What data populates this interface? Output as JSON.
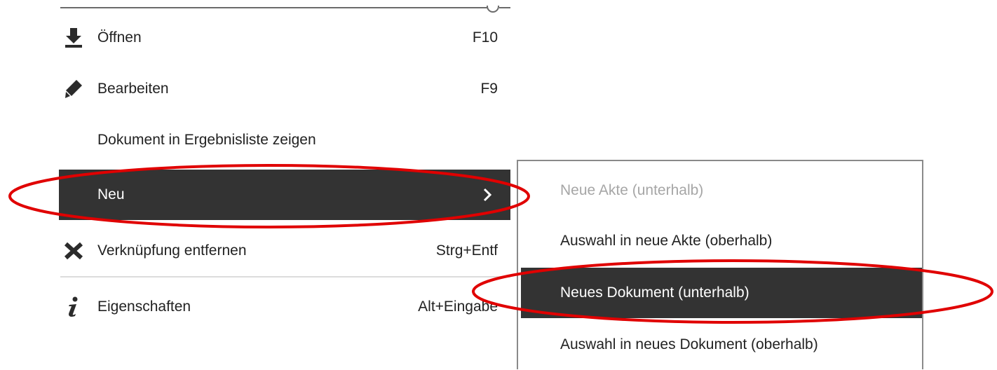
{
  "context_menu": {
    "items": [
      {
        "label": "Öffnen",
        "shortcut": "F10",
        "icon": "download-icon"
      },
      {
        "label": "Bearbeiten",
        "shortcut": "F9",
        "icon": "pencil-icon"
      },
      {
        "label": "Dokument in Ergebnisliste zeigen",
        "shortcut": ""
      },
      {
        "label": "Neu",
        "shortcut": "",
        "has_submenu": true,
        "highlighted": true
      },
      {
        "label": "Verknüpfung entfernen",
        "shortcut": "Strg+Entf",
        "icon": "x-icon"
      },
      {
        "label": "Eigenschaften",
        "shortcut": "Alt+Eingabe",
        "icon": "info-icon"
      }
    ]
  },
  "submenu": {
    "items": [
      {
        "label": "Neue Akte (unterhalb)",
        "disabled": true
      },
      {
        "label": "Auswahl in neue Akte (oberhalb)"
      },
      {
        "label": "Neues Dokument (unterhalb)",
        "highlighted": true
      },
      {
        "label": "Auswahl in neues Dokument (oberhalb)"
      }
    ]
  },
  "colors": {
    "highlight_bg": "#333333",
    "annotation_red": "#e00000",
    "disabled_text": "#a6a6a6"
  }
}
